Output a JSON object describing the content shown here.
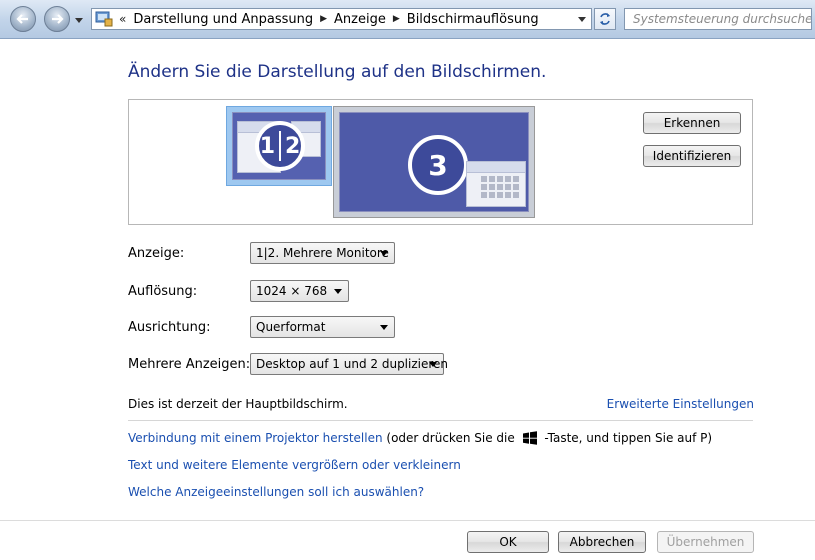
{
  "nav": {
    "breadcrumb": [
      "Darstellung und Anpassung",
      "Anzeige",
      "Bildschirmauflösung"
    ],
    "breadcrumb_overflow": "«",
    "search_placeholder": "Systemsteuerung durchsuchen"
  },
  "page": {
    "title": "Ändern Sie die Darstellung auf den Bildschirmen."
  },
  "monitors": {
    "monitor_a_label_1": "1",
    "monitor_a_label_2": "2",
    "monitor_b_label": "3",
    "detect_button": "Erkennen",
    "identify_button": "Identifizieren"
  },
  "settings": {
    "display_label": "Anzeige:",
    "display_value": "1|2. Mehrere Monitore",
    "resolution_label": "Auflösung:",
    "resolution_value": "1024 × 768",
    "orientation_label": "Ausrichtung:",
    "orientation_value": "Querformat",
    "multiple_label": "Mehrere Anzeigen:",
    "multiple_value": "Desktop auf 1 und 2 duplizieren"
  },
  "status": {
    "primary_text": "Dies ist derzeit der Hauptbildschirm.",
    "advanced_link": "Erweiterte Einstellungen"
  },
  "links": {
    "projector_link": "Verbindung mit einem Projektor herstellen",
    "projector_hint_before": "(oder drücken Sie die",
    "projector_hint_after": "-Taste, und tippen Sie auf P)",
    "enlarge_link": "Text und weitere Elemente vergrößern oder verkleinern",
    "which_link": "Welche Anzeigeeinstellungen soll ich auswählen?"
  },
  "footer": {
    "ok_button": "OK",
    "cancel_button": "Abbrechen",
    "apply_button": "Übernehmen"
  },
  "icons": {
    "back": "back-arrow-icon",
    "forward": "forward-arrow-icon",
    "control_panel": "control-panel-icon",
    "refresh": "refresh-icon",
    "windows_key": "windows-logo-icon"
  },
  "colors": {
    "title": "#1e3287",
    "link": "#1a4fb0",
    "selected_monitor": "#9ec8f0",
    "monitor_screen": "#4e5aa8"
  }
}
